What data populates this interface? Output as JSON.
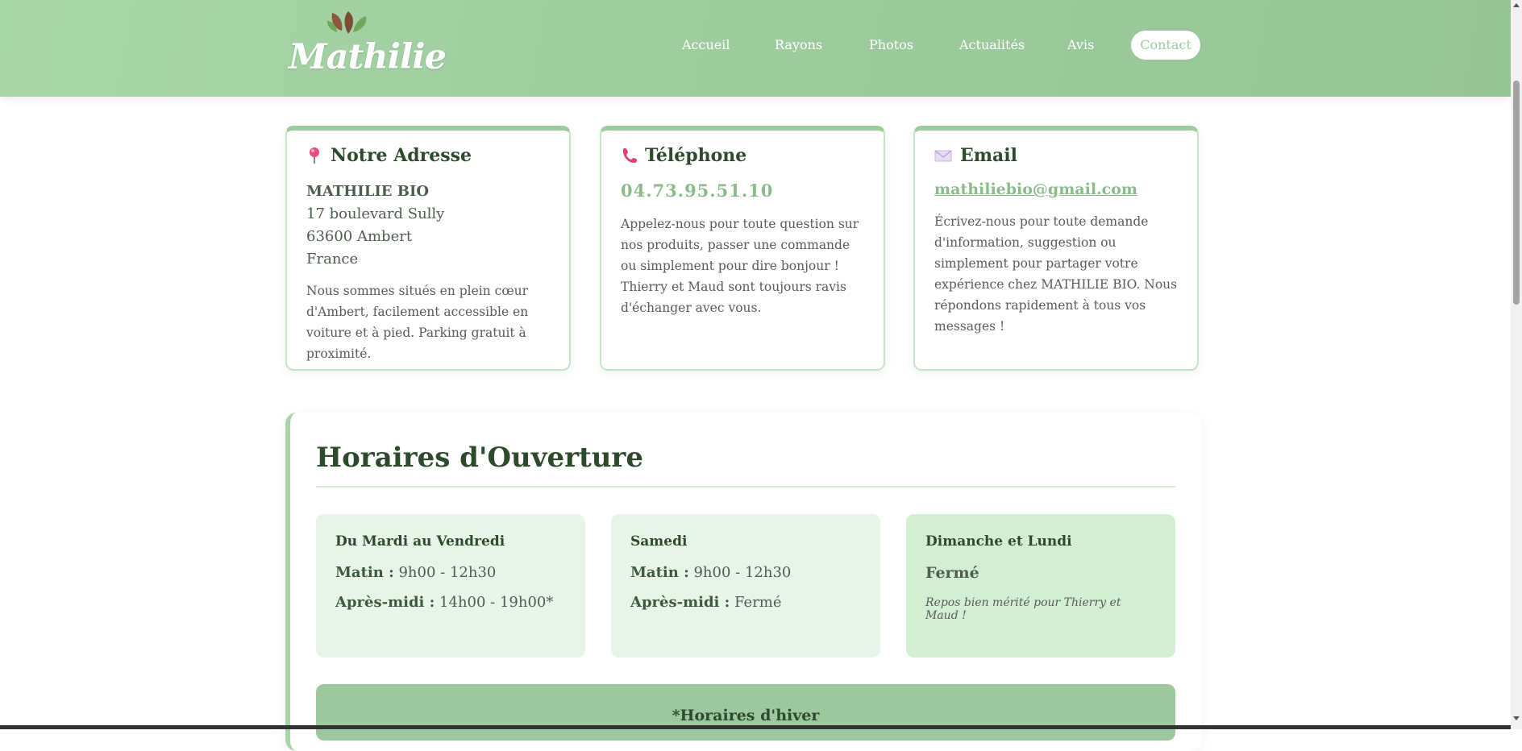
{
  "header": {
    "logo_text": "Mathilie",
    "nav": [
      {
        "label": "Accueil"
      },
      {
        "label": "Rayons"
      },
      {
        "label": "Photos"
      },
      {
        "label": "Actualités"
      },
      {
        "label": "Avis"
      },
      {
        "label": "Contact"
      }
    ],
    "colors": {
      "header_bg": "#a3d0a3",
      "accent": "#9dcb9d"
    }
  },
  "cards": {
    "address": {
      "icon": "pin-icon",
      "title": "Notre Adresse",
      "name": "MATHILIE BIO",
      "street": "17 boulevard Sully",
      "city": "63600 Ambert",
      "country": "France",
      "text": "Nous sommes situés en plein cœur d'Ambert, facilement accessible en voiture et à pied. Parking gratuit à proximité."
    },
    "phone": {
      "icon": "phone-icon",
      "title": "Téléphone",
      "number": "04.73.95.51.10",
      "text": "Appelez-nous pour toute question sur nos produits, passer une commande ou simplement pour dire bonjour ! Thierry et Maud sont toujours ravis d'échanger avec vous."
    },
    "email": {
      "icon": "envelope-icon",
      "title": "Email",
      "address": "mathiliebio@gmail.com",
      "text": "Écrivez-nous pour toute demande d'information, suggestion ou simplement pour partager votre expérience chez MATHILIE BIO. Nous répondons rapidement à tous vos messages !"
    }
  },
  "hours": {
    "title": "Horaires d'Ouverture",
    "weekdays": {
      "title": "Du Mardi au Vendredi",
      "morning_label": "Matin :",
      "morning_value": "9h00 - 12h30",
      "afternoon_label": "Après-midi :",
      "afternoon_value": "14h00 - 19h00*"
    },
    "saturday": {
      "title": "Samedi",
      "morning_label": "Matin :",
      "morning_value": "9h00 - 12h30",
      "afternoon_label": "Après-midi :",
      "afternoon_value": "Fermé"
    },
    "closed": {
      "title": "Dimanche et Lundi",
      "status": "Fermé",
      "note": "Repos bien mérité pour Thierry et Maud !"
    },
    "winter_title": "*Horaires d'hiver"
  }
}
